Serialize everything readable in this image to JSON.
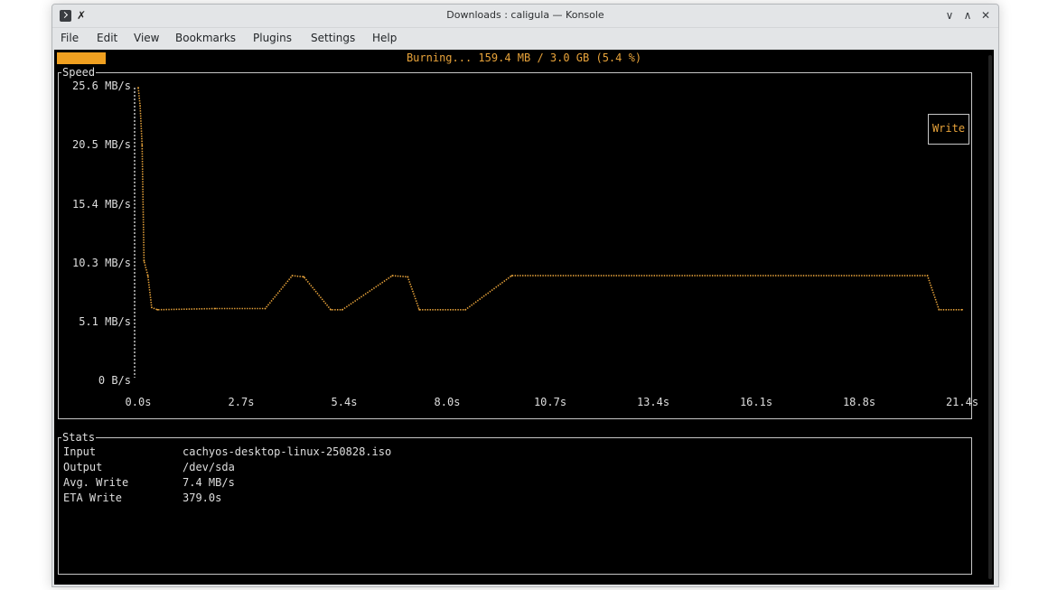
{
  "window": {
    "title": "Downloads : caligula — Konsole",
    "pin_symbol": "✗",
    "controls": {
      "minimize": "∨",
      "maximize": "∧",
      "close": "✕"
    }
  },
  "menu": [
    "File",
    "Edit",
    "View",
    "Bookmarks",
    "Plugins",
    "Settings",
    "Help"
  ],
  "progress": {
    "text": "Burning... 159.4 MB / 3.0 GB (5.4 %)",
    "fraction": 0.054
  },
  "speed_panel": {
    "title": "Speed",
    "legend": "Write",
    "colors": {
      "accent": "#e8a33a",
      "border": "#c6c6c6",
      "text": "#dedede"
    }
  },
  "chart_data": {
    "type": "line",
    "title": "Speed",
    "xlabel": "",
    "ylabel": "",
    "y_ticks": [
      "25.6 MB/s",
      "20.5 MB/s",
      "15.4 MB/s",
      "10.3 MB/s",
      "5.1 MB/s",
      "0 B/s"
    ],
    "x_ticks": [
      "0.0s",
      "2.7s",
      "5.4s",
      "8.0s",
      "10.7s",
      "13.4s",
      "16.1s",
      "18.8s",
      "21.4s"
    ],
    "xlim": [
      0,
      21.4
    ],
    "ylim": [
      0,
      25.6
    ],
    "legend_position": "top-right",
    "series": [
      {
        "name": "Write",
        "color": "#e8a33a",
        "x": [
          0.0,
          0.05,
          0.1,
          0.15,
          0.25,
          0.35,
          0.5,
          2.0,
          3.3,
          4.0,
          4.3,
          5.0,
          5.3,
          6.6,
          7.0,
          7.3,
          8.5,
          9.7,
          20.5,
          20.8,
          21.4
        ],
        "y": [
          25.6,
          24.0,
          20.5,
          10.3,
          9.0,
          6.2,
          6.0,
          6.1,
          6.1,
          9.0,
          8.9,
          6.0,
          6.0,
          9.0,
          8.9,
          6.0,
          6.0,
          9.0,
          9.0,
          6.0,
          6.0
        ]
      }
    ]
  },
  "stats": {
    "title": "Stats",
    "rows": [
      {
        "label": "Input",
        "value": "cachyos-desktop-linux-250828.iso"
      },
      {
        "label": "Output",
        "value": "/dev/sda"
      },
      {
        "label": "Avg. Write",
        "value": "7.4 MB/s"
      },
      {
        "label": "ETA Write",
        "value": "379.0s"
      }
    ]
  }
}
